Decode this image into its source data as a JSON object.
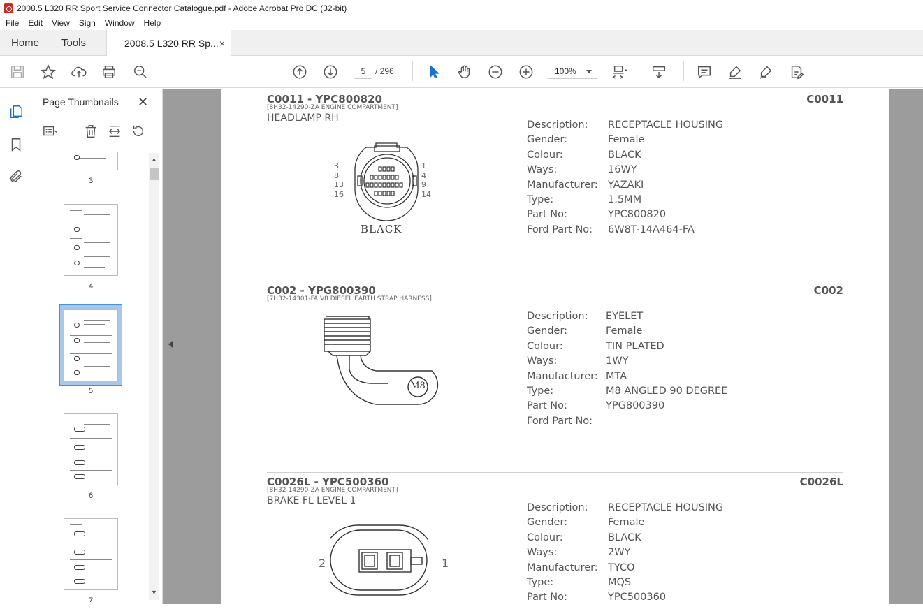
{
  "window": {
    "title": "2008.5 L320 RR Sport Service Connector Catalogue.pdf - Adobe Acrobat Pro DC (32-bit)"
  },
  "menu": [
    "File",
    "Edit",
    "View",
    "Sign",
    "Window",
    "Help"
  ],
  "tabs": {
    "home": "Home",
    "tools": "Tools",
    "document": "2008.5 L320 RR Sp...",
    "close": "×"
  },
  "toolbar": {
    "page_current": "5",
    "page_total": "/  296",
    "zoom": "100%",
    "icons": [
      "save-icon",
      "bookmark-star-icon",
      "upload-cloud-icon",
      "print-icon",
      "search-zoom-icon",
      "prev-page-icon",
      "next-page-icon",
      "select-pointer-icon",
      "hand-icon",
      "zoom-out-icon",
      "zoom-in-icon",
      "page-fit-icon",
      "scroll-mode-icon",
      "comment-icon",
      "highlight-icon",
      "sign-icon",
      "edit-pdf-icon"
    ]
  },
  "panel": {
    "title": "Page Thumbnails",
    "close": "✕",
    "thumbnails": [
      {
        "label": "3"
      },
      {
        "label": "4"
      },
      {
        "label": "5",
        "selected": true
      },
      {
        "label": "6"
      },
      {
        "label": "7"
      }
    ]
  },
  "document": {
    "connectors": [
      {
        "code": "C0011 - YPC800820",
        "code_right": "C0011",
        "harness": "[8H32-14290-ZA ENGINE COMPARTMENT]",
        "location": "HEADLAMP RH",
        "image_label": "BLACK",
        "pin_labels_left": [
          "3",
          "8",
          "13",
          "16"
        ],
        "pin_labels_right": [
          "1",
          "4",
          "9",
          "14"
        ],
        "specs": [
          {
            "key": "Description:",
            "value": "RECEPTACLE HOUSING"
          },
          {
            "key": "Gender:",
            "value": "Female"
          },
          {
            "key": "Colour:",
            "value": "BLACK"
          },
          {
            "key": "Ways:",
            "value": "16WY"
          },
          {
            "key": "Manufacturer:",
            "value": "YAZAKI"
          },
          {
            "key": "Type:",
            "value": "1.5MM"
          },
          {
            "key": "Part No:",
            "value": "YPC800820"
          },
          {
            "key": "Ford Part No:",
            "value": "6W8T-14A464-FA"
          }
        ]
      },
      {
        "code": "C002 - YPG800390",
        "code_right": "C002",
        "harness": "[7H32-14301-FA V8 DIESEL EARTH STRAP HARNESS]",
        "location": "",
        "image_label": "M8",
        "specs": [
          {
            "key": "Description:",
            "value": "EYELET"
          },
          {
            "key": "Gender:",
            "value": "Female"
          },
          {
            "key": "Colour:",
            "value": "TIN PLATED"
          },
          {
            "key": "Ways:",
            "value": "1WY"
          },
          {
            "key": "Manufacturer:",
            "value": "MTA"
          },
          {
            "key": "Type:",
            "value": "M8 ANGLED 90 DEGREE"
          },
          {
            "key": "Part No:",
            "value": "YPG800390"
          },
          {
            "key": "Ford Part No:",
            "value": ""
          }
        ]
      },
      {
        "code": "C0026L - YPC500360",
        "code_right": "C0026L",
        "harness": "[8H32-14290-ZA ENGINE COMPARTMENT]",
        "location": "BRAKE FL LEVEL 1",
        "pin_label_left": "2",
        "pin_label_right": "1",
        "specs": [
          {
            "key": "Description:",
            "value": "RECEPTACLE HOUSING"
          },
          {
            "key": "Gender:",
            "value": "Female"
          },
          {
            "key": "Colour:",
            "value": "BLACK"
          },
          {
            "key": "Ways:",
            "value": "2WY"
          },
          {
            "key": "Manufacturer:",
            "value": "TYCO"
          },
          {
            "key": "Type:",
            "value": "MQS"
          },
          {
            "key": "Part No:",
            "value": "YPC500360"
          }
        ]
      }
    ]
  }
}
